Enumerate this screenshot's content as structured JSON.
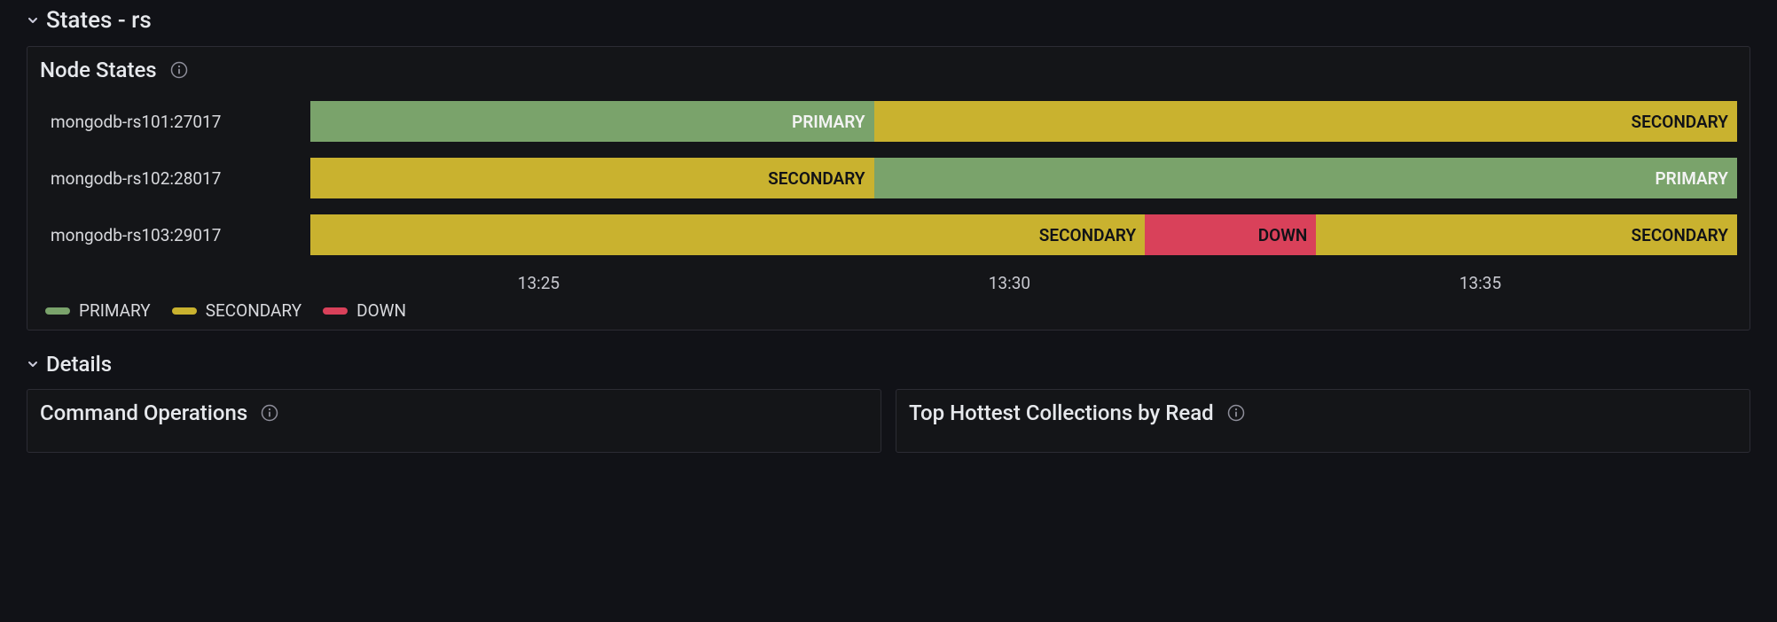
{
  "sections": {
    "states_title": "States - rs",
    "details_title": "Details"
  },
  "node_states_panel": {
    "title": "Node States",
    "rows": [
      {
        "label": "mongodb-rs101:27017",
        "segments": [
          {
            "state": "PRIMARY",
            "width_pct": 39.5
          },
          {
            "state": "SECONDARY",
            "width_pct": 60.5
          }
        ]
      },
      {
        "label": "mongodb-rs102:28017",
        "segments": [
          {
            "state": "SECONDARY",
            "width_pct": 39.5
          },
          {
            "state": "PRIMARY",
            "width_pct": 60.5
          }
        ]
      },
      {
        "label": "mongodb-rs103:29017",
        "segments": [
          {
            "state": "SECONDARY",
            "width_pct": 58.5
          },
          {
            "state": "DOWN",
            "width_pct": 12.0
          },
          {
            "state": "SECONDARY",
            "width_pct": 29.5
          }
        ]
      }
    ],
    "axis_ticks": [
      {
        "label": "13:25",
        "pos_pct": 16
      },
      {
        "label": "13:30",
        "pos_pct": 49
      },
      {
        "label": "13:35",
        "pos_pct": 82
      }
    ],
    "legend": [
      {
        "state": "PRIMARY",
        "label": "PRIMARY"
      },
      {
        "state": "SECONDARY",
        "label": "SECONDARY"
      },
      {
        "state": "DOWN",
        "label": "DOWN"
      }
    ]
  },
  "details_panels": {
    "command_ops_title": "Command Operations",
    "hottest_title": "Top Hottest Collections by Read"
  },
  "colors": {
    "primary": "#7aa36b",
    "secondary": "#c9b22f",
    "down": "#d9415a"
  },
  "chart_data": {
    "type": "bar",
    "title": "Node States",
    "x_range": [
      "13:23",
      "13:38"
    ],
    "x_ticks": [
      "13:25",
      "13:30",
      "13:35"
    ],
    "states": [
      "PRIMARY",
      "SECONDARY",
      "DOWN"
    ],
    "series": [
      {
        "name": "mongodb-rs101:27017",
        "segments": [
          {
            "state": "PRIMARY",
            "approx_start": "13:23",
            "approx_end": "13:29"
          },
          {
            "state": "SECONDARY",
            "approx_start": "13:29",
            "approx_end": "13:38"
          }
        ]
      },
      {
        "name": "mongodb-rs102:28017",
        "segments": [
          {
            "state": "SECONDARY",
            "approx_start": "13:23",
            "approx_end": "13:29"
          },
          {
            "state": "PRIMARY",
            "approx_start": "13:29",
            "approx_end": "13:38"
          }
        ]
      },
      {
        "name": "mongodb-rs103:29017",
        "segments": [
          {
            "state": "SECONDARY",
            "approx_start": "13:23",
            "approx_end": "13:32"
          },
          {
            "state": "DOWN",
            "approx_start": "13:32",
            "approx_end": "13:34"
          },
          {
            "state": "SECONDARY",
            "approx_start": "13:34",
            "approx_end": "13:38"
          }
        ]
      }
    ]
  }
}
